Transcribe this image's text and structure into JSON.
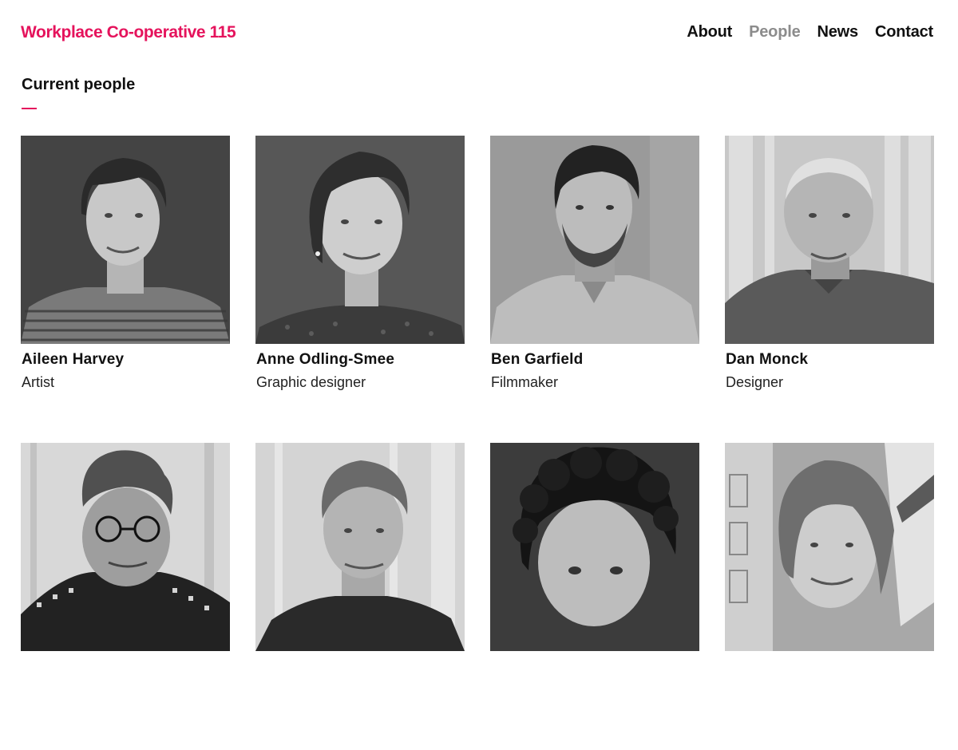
{
  "site": {
    "logo": "Workplace Co-operative 115"
  },
  "nav": {
    "items": [
      {
        "label": "About"
      },
      {
        "label": "People",
        "active": true
      },
      {
        "label": "News"
      },
      {
        "label": "Contact"
      }
    ]
  },
  "colors": {
    "accent": "#e5135c",
    "nav_active": "#8c8c8c"
  },
  "section": {
    "title": "Current people"
  },
  "people": [
    {
      "name": "Aileen Harvey",
      "role": "Artist"
    },
    {
      "name": "Anne Odling-Smee",
      "role": "Graphic designer"
    },
    {
      "name": "Ben Garfield",
      "role": "Filmmaker"
    },
    {
      "name": "Dan Monck",
      "role": "Designer"
    },
    {
      "name": "",
      "role": ""
    },
    {
      "name": "",
      "role": ""
    },
    {
      "name": "",
      "role": ""
    },
    {
      "name": "",
      "role": ""
    }
  ]
}
